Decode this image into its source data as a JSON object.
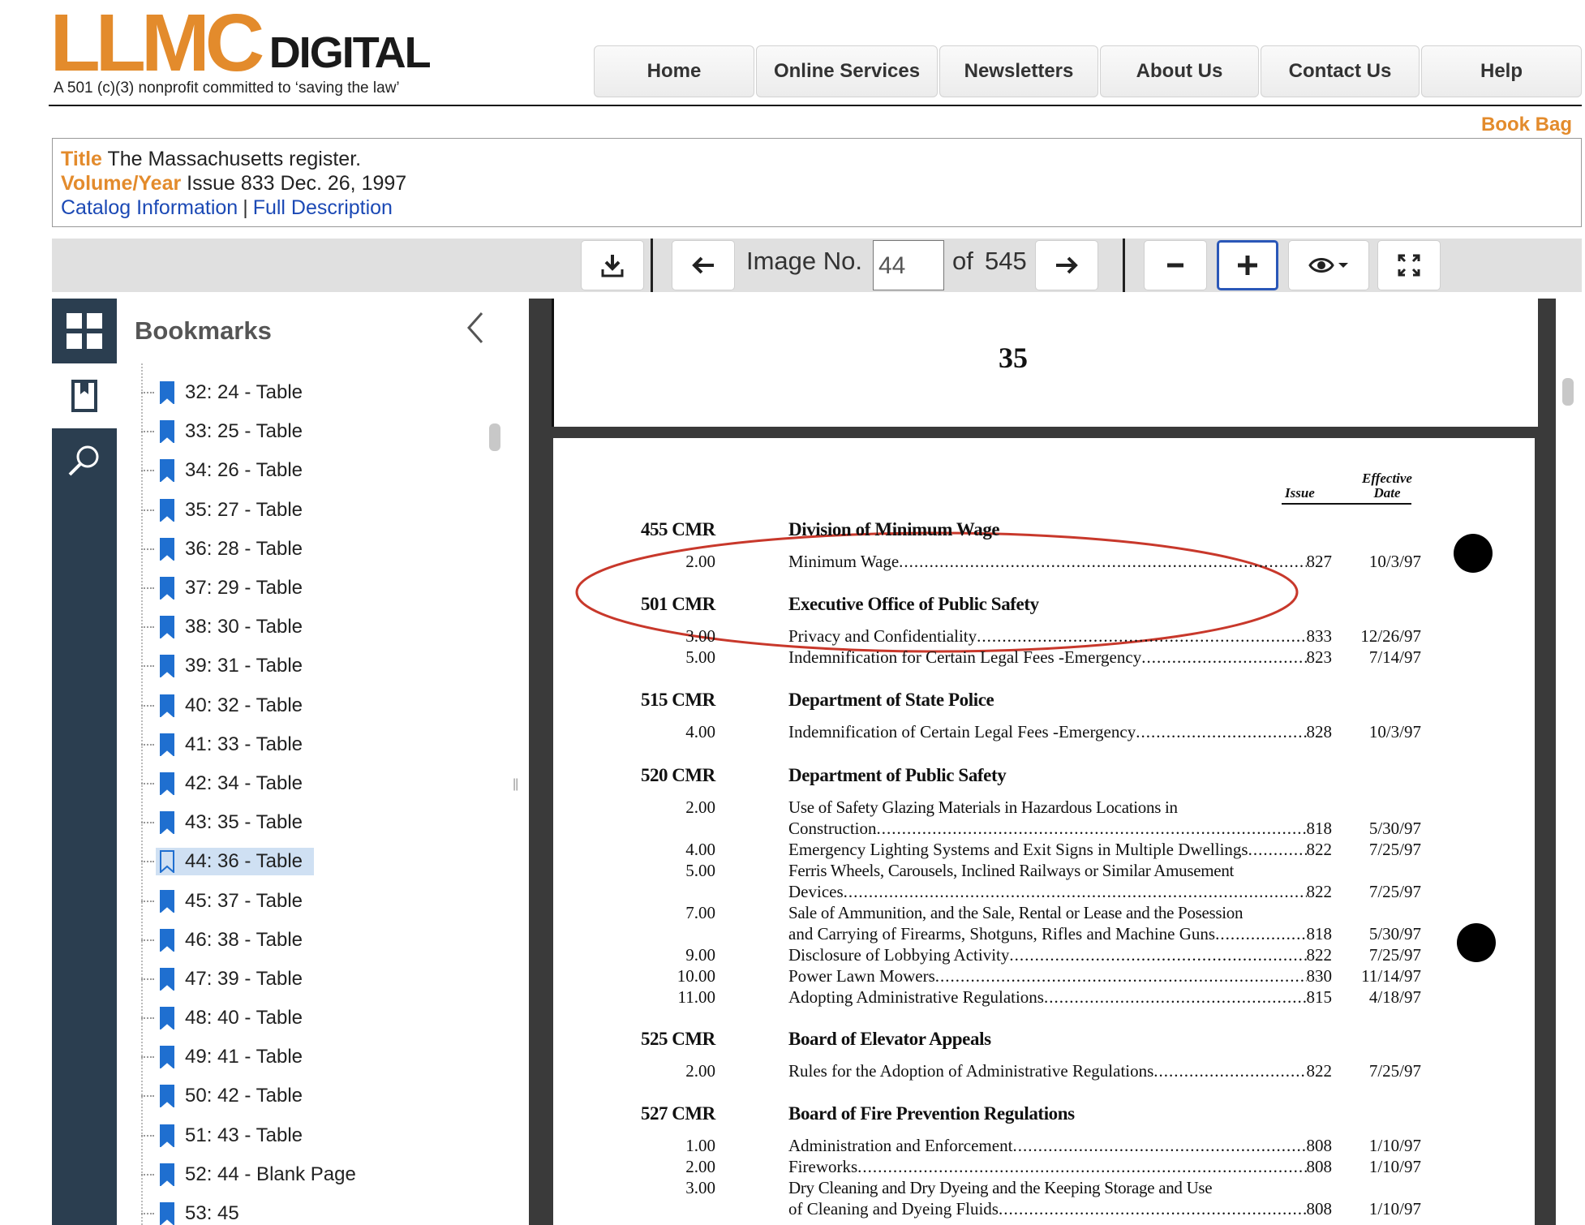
{
  "brand": {
    "logo_main": "LLMC",
    "logo_sub": "DIGITAL",
    "tagline": "A 501 (c)(3) nonprofit committed to ‘saving the law’"
  },
  "nav": [
    "Home",
    "Online Services",
    "Newsletters",
    "About Us",
    "Contact Us",
    "Help"
  ],
  "book_bag": "Book Bag",
  "record": {
    "title_label": "Title",
    "title_value": "The Massachusetts register.",
    "volume_label": "Volume/Year",
    "volume_value": "Issue 833 Dec. 26, 1997",
    "catalog_link": "Catalog Information",
    "separator": "|",
    "full_desc_link": "Full Description"
  },
  "toolbar": {
    "image_no_label": "Image No.",
    "image_no_value": "44",
    "of_label": "of",
    "total_images": "545"
  },
  "sidebar": {
    "title": "Bookmarks",
    "current_index": 12,
    "items": [
      "32: 24 - Table",
      "33: 25 - Table",
      "34: 26 - Table",
      "35: 27 - Table",
      "36: 28 - Table",
      "37: 29 - Table",
      "38: 30 - Table",
      "39: 31 - Table",
      "40: 32 - Table",
      "41: 33 - Table",
      "42: 34 - Table",
      "43: 35 - Table",
      "44: 36 - Table",
      "45: 37 - Table",
      "46: 38 - Table",
      "47: 39 - Table",
      "48: 40 - Table",
      "49: 41 - Table",
      "50: 42 - Table",
      "51: 43 - Table",
      "52: 44 - Blank Page",
      "53: 45"
    ]
  },
  "document": {
    "prev_page_number": "35",
    "col_issue": "Issue",
    "col_effective_1": "Effective",
    "col_effective_2": "Date",
    "annotation_color": "#c8382b",
    "sections": [
      {
        "cmr": "455 CMR",
        "agency": "Division of Minimum Wage",
        "rows": [
          {
            "num": "2.00",
            "text": [
              "Minimum Wage"
            ],
            "issue": "827",
            "eff": "10/3/97"
          }
        ]
      },
      {
        "cmr": "501 CMR",
        "agency": "Executive Office of Public Safety",
        "rows": [
          {
            "num": "3.00",
            "text": [
              "Privacy and Confidentiality"
            ],
            "issue": "833",
            "eff": "12/26/97"
          },
          {
            "num": "5.00",
            "text": [
              "Indemnification for Certain Legal Fees -Emergency"
            ],
            "issue": "823",
            "eff": "7/14/97"
          }
        ]
      },
      {
        "cmr": "515 CMR",
        "agency": "Department of State Police",
        "rows": [
          {
            "num": "4.00",
            "text": [
              "Indemnification of Certain Legal Fees -Emergency"
            ],
            "issue": "828",
            "eff": "10/3/97"
          }
        ]
      },
      {
        "cmr": "520 CMR",
        "agency": "Department of Public Safety",
        "rows": [
          {
            "num": "2.00",
            "text": [
              "Use of Safety Glazing Materials in Hazardous Locations in",
              "Construction"
            ],
            "issue": "818",
            "eff": "5/30/97"
          },
          {
            "num": "4.00",
            "text": [
              "Emergency Lighting Systems and Exit Signs in Multiple Dwellings"
            ],
            "issue": "822",
            "eff": "7/25/97"
          },
          {
            "num": "5.00",
            "text": [
              "Ferris Wheels, Carousels, Inclined Railways or Similar Amusement",
              "Devices"
            ],
            "issue": "822",
            "eff": "7/25/97"
          },
          {
            "num": "7.00",
            "text": [
              "Sale of Ammunition, and the Sale, Rental or Lease and the Posession",
              "and Carrying of Firearms, Shotguns, Rifles and Machine Guns"
            ],
            "issue": "818",
            "eff": "5/30/97"
          },
          {
            "num": "9.00",
            "text": [
              "Disclosure of Lobbying Activity"
            ],
            "issue": "822",
            "eff": "7/25/97"
          },
          {
            "num": "10.00",
            "text": [
              "Power Lawn Mowers"
            ],
            "issue": "830",
            "eff": "11/14/97"
          },
          {
            "num": "11.00",
            "text": [
              "Adopting Administrative Regulations"
            ],
            "issue": "815",
            "eff": "4/18/97"
          }
        ]
      },
      {
        "cmr": "525 CMR",
        "agency": "Board of Elevator Appeals",
        "rows": [
          {
            "num": "2.00",
            "text": [
              "Rules for the Adoption of Administrative Regulations"
            ],
            "issue": "822",
            "eff": "7/25/97"
          }
        ]
      },
      {
        "cmr": "527 CMR",
        "agency": "Board of Fire Prevention Regulations",
        "rows": [
          {
            "num": "1.00",
            "text": [
              "Administration and Enforcement"
            ],
            "issue": "808",
            "eff": "1/10/97"
          },
          {
            "num": "2.00",
            "text": [
              "Fireworks"
            ],
            "issue": "808",
            "eff": "1/10/97"
          },
          {
            "num": "3.00",
            "text": [
              "Dry Cleaning and Dry Dyeing and the Keeping Storage and Use",
              "of Cleaning and Dyeing Fluids"
            ],
            "issue": "808",
            "eff": "1/10/97"
          }
        ]
      }
    ]
  }
}
